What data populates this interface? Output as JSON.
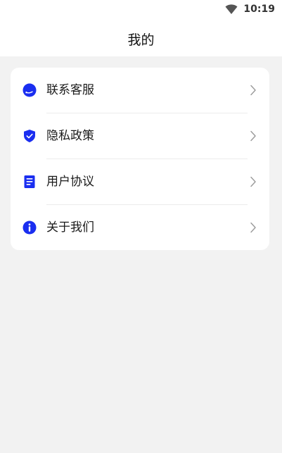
{
  "status_bar": {
    "time": "10:19",
    "wifi_icon": "wifi-icon"
  },
  "header": {
    "title": "我的"
  },
  "menu": {
    "accent_color": "#1a2ef0",
    "items": [
      {
        "label": "联系客服",
        "icon": "customer-service-icon"
      },
      {
        "label": "隐私政策",
        "icon": "shield-check-icon"
      },
      {
        "label": "用户协议",
        "icon": "document-icon"
      },
      {
        "label": "关于我们",
        "icon": "info-icon"
      }
    ],
    "chevron_icon": "chevron-right-icon"
  }
}
